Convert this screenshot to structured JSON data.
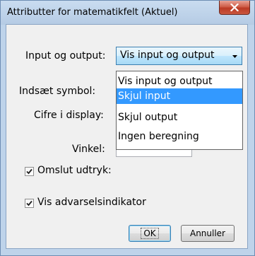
{
  "window": {
    "title": "Attributter for matematikfelt (Aktuel)",
    "close_icon": "close-x-icon"
  },
  "form": {
    "input_output_label": "Input og output:",
    "insert_symbol_label": "Indsæt symbol:",
    "digits_label": "Cifre i display:",
    "angle_label": "Vinkel:",
    "input_output_value": "Vis input og output",
    "dropdown_options": [
      "Vis input og output",
      "Skjul input",
      "Skjul output",
      "Ingen beregning"
    ],
    "dropdown_highlighted": "Skjul input",
    "wrap_expression_label": "Omslut udtryk:",
    "wrap_expression_checked": true,
    "warning_indicator_label": "Vis advarselsindikator",
    "warning_indicator_checked": true
  },
  "buttons": {
    "ok": "OK",
    "cancel": "Annuller"
  },
  "colors": {
    "highlight": "#3399ff",
    "close_button": "#c9573f",
    "title_bar": "#bed3ea"
  }
}
